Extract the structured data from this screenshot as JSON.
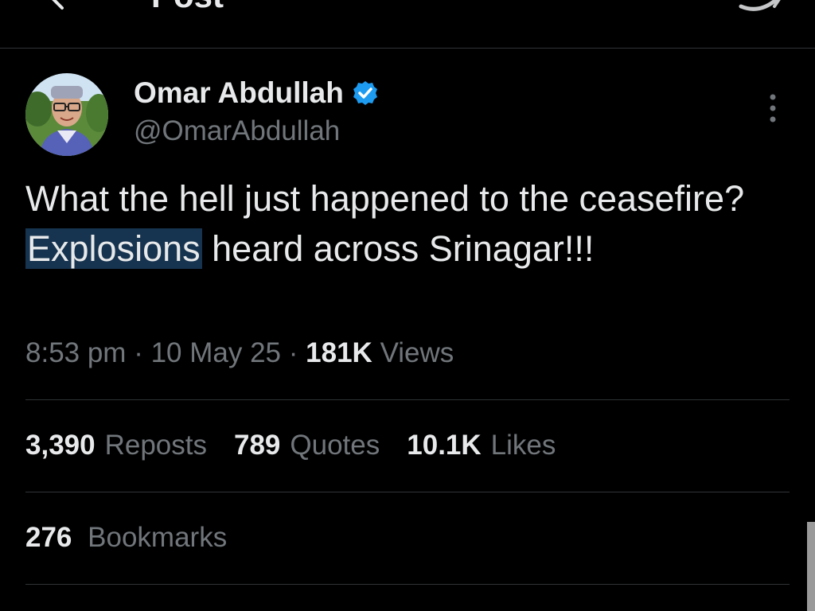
{
  "header": {
    "title": "Post",
    "back_icon": "arrow-left-icon",
    "reply_icon": "reply-icon"
  },
  "author": {
    "display_name": "Omar Abdullah",
    "handle": "@OmarAbdullah",
    "verified_icon": "verified-badge-icon",
    "verified_color": "#1d9bf0"
  },
  "tweet": {
    "text_before": "What the hell just happened to the ceasefire?",
    "text_highlight": "Explosions",
    "text_after": "heard across Srinagar!!!",
    "highlight_color": "#16334f"
  },
  "meta": {
    "time": "8:53 pm",
    "date": "10 May 25",
    "views_count": "181K",
    "views_label": "Views"
  },
  "stats": {
    "reposts_count": "3,390",
    "reposts_label": "Reposts",
    "quotes_count": "789",
    "quotes_label": "Quotes",
    "likes_count": "10.1K",
    "likes_label": "Likes",
    "bookmarks_count": "276",
    "bookmarks_label": "Bookmarks"
  },
  "colors": {
    "background": "#000000",
    "primary_text": "#e7e9ea",
    "secondary_text": "#71767b",
    "divider": "#2f3336"
  }
}
